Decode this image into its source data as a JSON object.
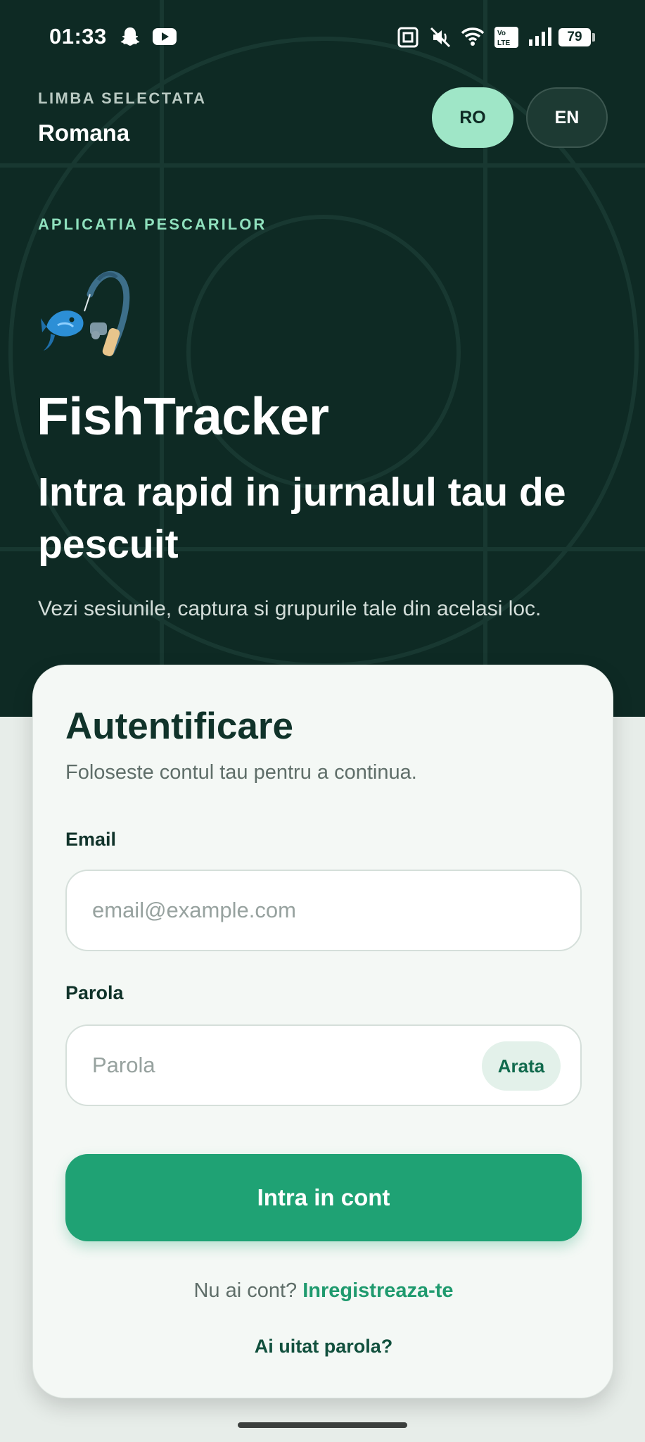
{
  "status_bar": {
    "time": "01:33",
    "battery": "79",
    "icons": [
      "snapchat-icon",
      "youtube-icon",
      "nfc-icon",
      "mute-icon",
      "wifi-icon",
      "volte-icon",
      "signal-icon",
      "battery-icon"
    ]
  },
  "language": {
    "caption": "LIMBA SELECTATA",
    "current": "Romana",
    "options": [
      {
        "code": "RO",
        "selected": true
      },
      {
        "code": "EN",
        "selected": false
      }
    ]
  },
  "hero": {
    "tag": "APLICATIA PESCARILOR",
    "logo_icon": "fishing-rod-icon",
    "app_name": "FishTracker",
    "headline": "Intra rapid in jurnalul tau de pescuit",
    "subhead": "Vezi sesiunile, captura si grupurile tale din acelasi loc."
  },
  "login": {
    "title": "Autentificare",
    "subtitle": "Foloseste contul tau pentru a continua.",
    "email_label": "Email",
    "email_placeholder": "email@example.com",
    "email_value": "",
    "password_label": "Parola",
    "password_placeholder": "Parola",
    "password_value": "",
    "show_password_label": "Arata",
    "submit_label": "Intra in cont",
    "register_prompt": "Nu ai cont?",
    "register_link": "Inregistreaza-te",
    "forgot_link": "Ai uitat parola?"
  },
  "colors": {
    "hero_bg": "#0e2a24",
    "accent": "#1fa274",
    "accent_light": "#9fe6c7",
    "card_bg": "#f4f8f5",
    "page_bg": "#e7ede9"
  }
}
